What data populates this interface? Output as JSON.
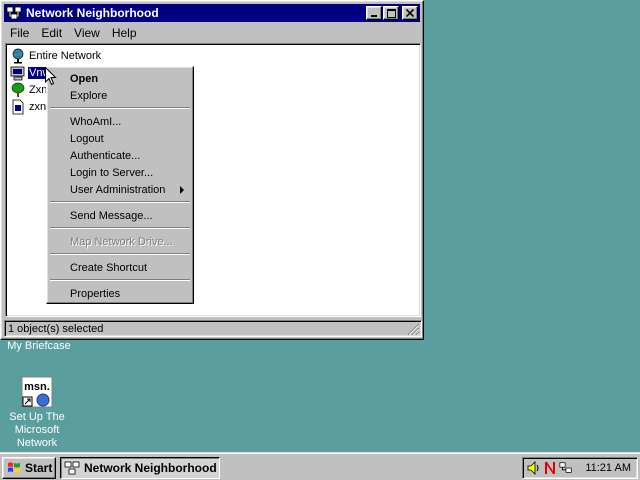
{
  "window": {
    "title": "Network Neighborhood",
    "menu": [
      "File",
      "Edit",
      "View",
      "Help"
    ],
    "items": [
      {
        "label": "Entire Network",
        "icon": "globe-network-icon"
      },
      {
        "label": "Vnw",
        "icon": "server-computer-icon",
        "selected": true
      },
      {
        "label": "Zxne",
        "icon": "tree-icon"
      },
      {
        "label": "zxne",
        "icon": "document-icon"
      }
    ],
    "status": "1 object(s) selected"
  },
  "context_menu": {
    "groups": [
      [
        {
          "label": "Open",
          "bold": true
        },
        {
          "label": "Explore"
        }
      ],
      [
        {
          "label": "WhoAmI..."
        },
        {
          "label": "Logout"
        },
        {
          "label": "Authenticate..."
        },
        {
          "label": "Login to Server..."
        },
        {
          "label": "User Administration",
          "submenu": true
        }
      ],
      [
        {
          "label": "Send Message..."
        }
      ],
      [
        {
          "label": "Map Network Drive...",
          "disabled": true
        }
      ],
      [
        {
          "label": "Create Shortcut"
        }
      ],
      [
        {
          "label": "Properties"
        }
      ]
    ]
  },
  "desktop": {
    "briefcase_label": "My Briefcase",
    "msn_label": "Set Up The Microsoft Network",
    "msn_icon_text": "msn."
  },
  "taskbar": {
    "start_label": "Start",
    "task_label": "Network Neighborhood",
    "clock": "11:21 AM"
  },
  "colors": {
    "desktop": "#5a9e9e",
    "title_bar": "#000080",
    "selection": "#000080",
    "face": "#c0c0c0"
  }
}
